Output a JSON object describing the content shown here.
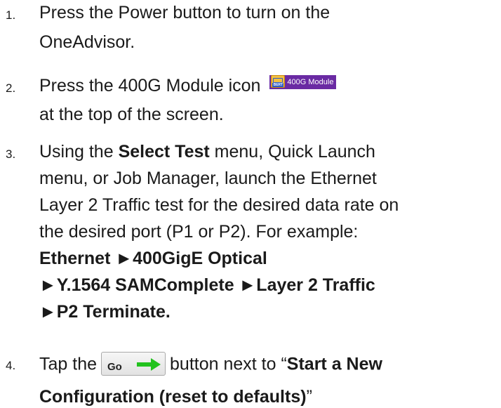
{
  "steps": [
    {
      "number": "1.",
      "lines": [
        "Press the Power button to turn on the",
        "OneAdvisor."
      ]
    },
    {
      "number": "2.",
      "line1_text": "Press the 400G Module icon",
      "badge_icon": "bert-icon",
      "badge_icon_text": "BERT",
      "badge_label": "400G Module",
      "badge_color": "#6a2aa3",
      "line2": "at the top of the screen."
    },
    {
      "number": "3.",
      "line1_pre": "Using the ",
      "line1_bold": "Select Test",
      "line1_post": " menu, Quick Launch",
      "line2": "menu, or Job Manager, launch the Ethernet",
      "line3": "Layer 2 Traffic test for the desired data rate on",
      "line4": "the desired port (P1 or P2).  For example:",
      "path_lines": [
        "Ethernet ►400GigE Optical",
        "►Y.1564 SAMComplete ►Layer 2 Traffic",
        "►P2 Terminate."
      ]
    },
    {
      "number": "4.",
      "line1_pre": "Tap the",
      "go_button_label": "Go",
      "go_arrow_icon": "right-arrow-icon",
      "go_arrow_color": "#22c21e",
      "line1_post": "button next to “",
      "line1_bold": "Start a New",
      "line2_bold": "Configuration (reset to defaults)",
      "line2_post": "”"
    }
  ]
}
